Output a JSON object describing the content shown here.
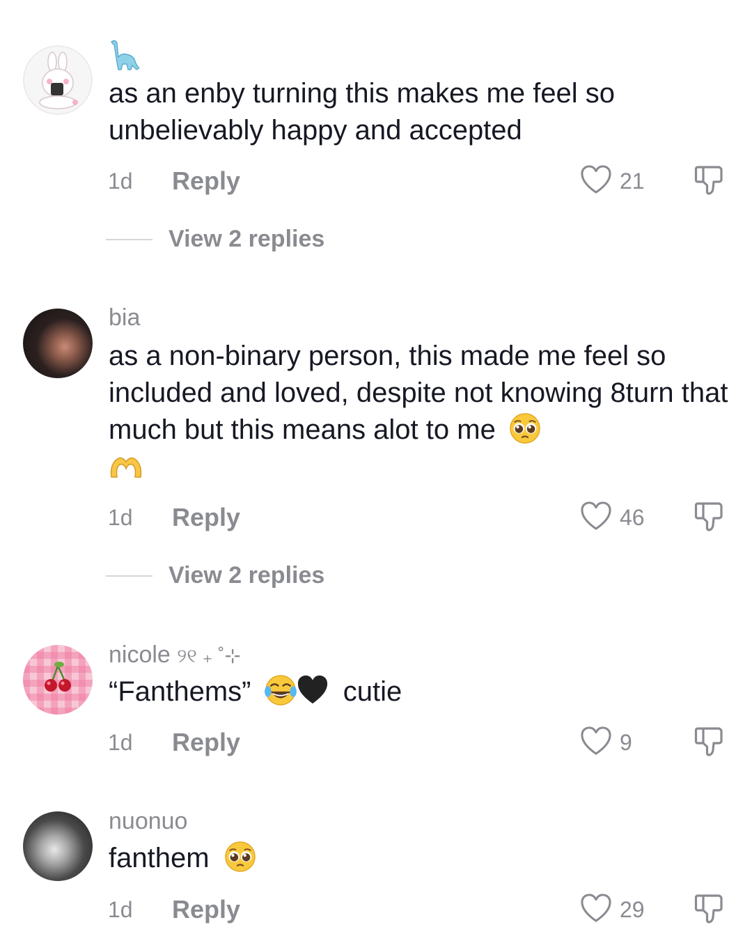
{
  "comments": [
    {
      "username": "",
      "text": "as an enby turning this makes me feel so unbelievably happy and accepted",
      "time": "1d",
      "reply_label": "Reply",
      "likes": "21",
      "view_replies": "View 2 replies"
    },
    {
      "username": "bia",
      "text": "as a non-binary person, this made me feel so included and loved, despite not knowing 8turn that much but this means alot to me",
      "time": "1d",
      "reply_label": "Reply",
      "likes": "46",
      "view_replies": "View 2 replies"
    },
    {
      "username": "nicole",
      "username_decoration": "୨୧ ₊ ˚⊹",
      "text_part1": "“Fanthems”",
      "text_part2": "cutie",
      "time": "1d",
      "reply_label": "Reply",
      "likes": "9"
    },
    {
      "username": "nuonuo",
      "text": "fanthem",
      "time": "1d",
      "reply_label": "Reply",
      "likes": "29"
    }
  ],
  "icons": {
    "like": "heart-outline-icon",
    "dislike": "thumbs-down-outline-icon",
    "username_icon_1": "dinosaur-emoji-icon",
    "emoji_pleading": "pleading-face-emoji",
    "emoji_heart_hands": "heart-hands-emoji",
    "emoji_laughing": "tears-of-joy-emoji",
    "emoji_black_heart": "black-heart-emoji"
  },
  "colors": {
    "text_primary": "#161823",
    "text_secondary": "#8a8b91",
    "divider": "#d6d6d8",
    "background": "#ffffff"
  }
}
